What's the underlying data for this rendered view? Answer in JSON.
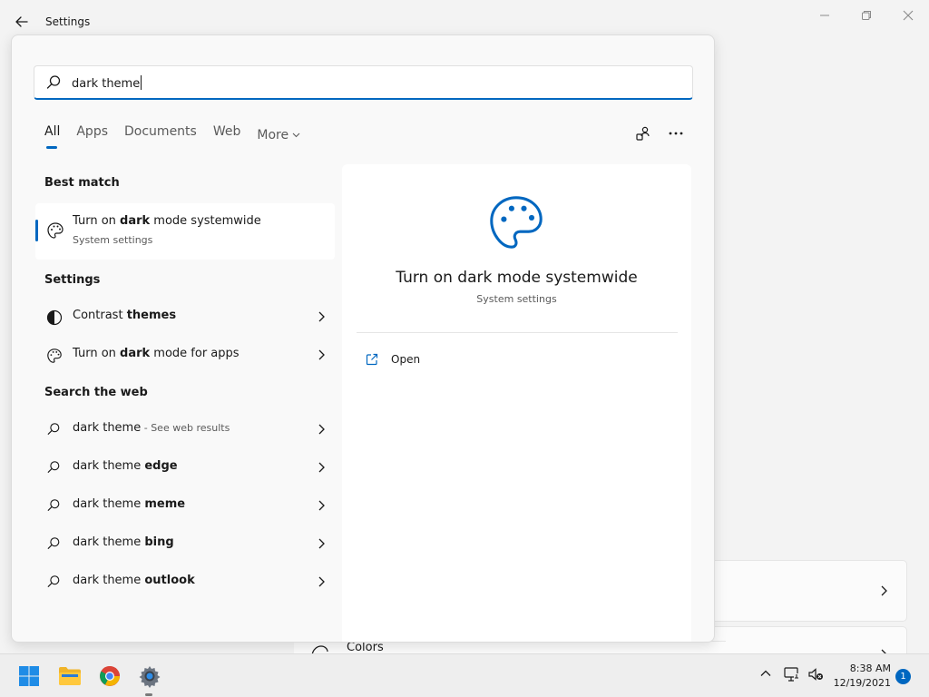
{
  "window": {
    "title": "Settings",
    "background_item_label": "Colors"
  },
  "search": {
    "query": "dark theme",
    "tabs": [
      "All",
      "Apps",
      "Documents",
      "Web",
      "More"
    ]
  },
  "best_match": {
    "heading": "Best match",
    "title_before": "Turn on ",
    "title_highlight": "dark",
    "title_after": " mode systemwide",
    "subtitle": "System settings"
  },
  "settings_section": {
    "heading": "Settings",
    "items": [
      {
        "before": "Contrast ",
        "highlight": "themes",
        "after": "",
        "icon": "contrast-icon"
      },
      {
        "before": "Turn on ",
        "highlight": "dark",
        "after": " mode for apps",
        "icon": "palette-icon"
      }
    ]
  },
  "web_section": {
    "heading": "Search the web",
    "items": [
      {
        "text": "dark theme",
        "highlight": "",
        "suffix": " - See web results"
      },
      {
        "text": "dark theme ",
        "highlight": "edge",
        "suffix": ""
      },
      {
        "text": "dark theme ",
        "highlight": "meme",
        "suffix": ""
      },
      {
        "text": "dark theme ",
        "highlight": "bing",
        "suffix": ""
      },
      {
        "text": "dark theme ",
        "highlight": "outlook",
        "suffix": ""
      }
    ]
  },
  "preview": {
    "title": "Turn on dark mode systemwide",
    "subtitle": "System settings",
    "action_open": "Open"
  },
  "taskbar": {
    "time": "8:38 AM",
    "date": "12/19/2021",
    "notification_count": "1"
  },
  "colors": {
    "accent": "#0067c0",
    "text": "#1a1a1a",
    "secondary_text": "#5a5a5a"
  }
}
